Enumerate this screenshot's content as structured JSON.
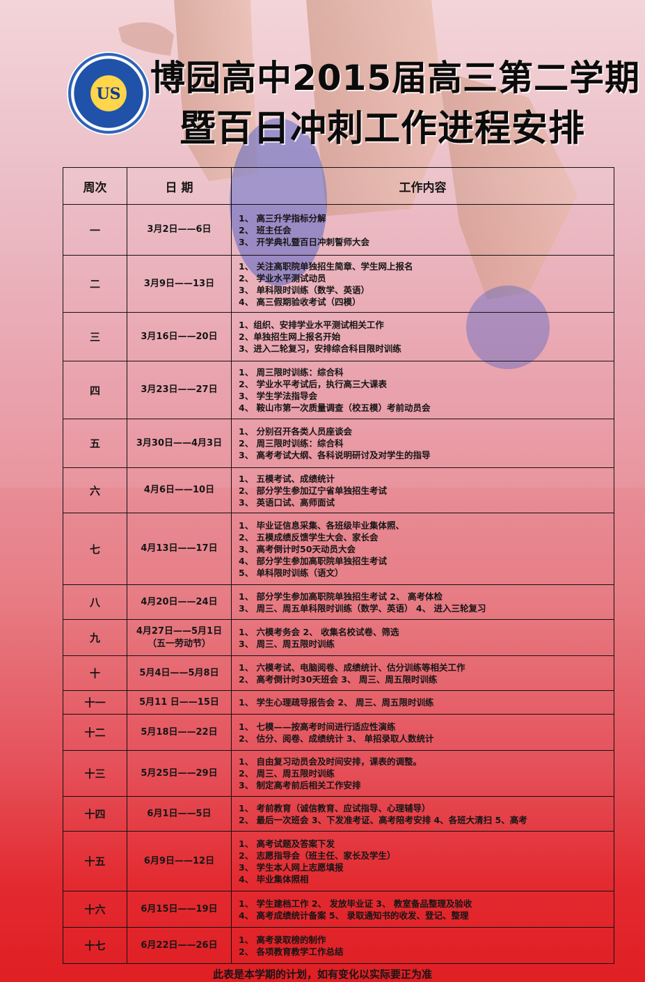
{
  "header": {
    "title_line1": "博园高中2015届高三第二学期",
    "title_line2": "暨百日冲刺工作进程安排"
  },
  "table": {
    "headers": [
      "周次",
      "日 期",
      "工作内容"
    ],
    "rows": [
      {
        "week": "一",
        "date": [
          "3月2日——6日"
        ],
        "tasks": [
          "1、 高三升学指标分解",
          "2、 班主任会",
          "3、 开学典礼暨百日冲刺誓师大会"
        ]
      },
      {
        "week": "二",
        "date": [
          "3月9日——13日"
        ],
        "tasks": [
          "1、 关注高职院单独招生简章、学生网上报名",
          "2、 学业水平测试动员",
          "3、 单科限时训练（数学、英语）",
          "4、 高三假期验收考试（四模）"
        ]
      },
      {
        "week": "三",
        "date": [
          "3月16日——20日"
        ],
        "tasks": [
          "1、组织、安排学业水平测试相关工作",
          "2、单独招生网上报名开始",
          "3、进入二轮复习，安排综合科目限时训练"
        ]
      },
      {
        "week": "四",
        "date": [
          "3月23日——27日"
        ],
        "tasks": [
          "1、 周三限时训练：综合科",
          "2、 学业水平考试后，执行高三大课表",
          "3、 学生学法指导会",
          "4、 鞍山市第一次质量调查（校五模）考前动员会"
        ]
      },
      {
        "week": "五",
        "date": [
          "3月30日——4月3日"
        ],
        "tasks": [
          "1、 分别召开各类人员座谈会",
          "2、 周三限时训练：综合科",
          "3、 高考考试大纲、各科说明研讨及对学生的指导"
        ]
      },
      {
        "week": "六",
        "date": [
          "4月6日——10日"
        ],
        "tasks": [
          "1、 五模考试、成绩统计",
          "2、 部分学生参加辽宁省单独招生考试",
          "3、 英语口试、高师面试"
        ]
      },
      {
        "week": "七",
        "date": [
          "4月13日——17日"
        ],
        "tasks": [
          "1、 毕业证信息采集、各班级毕业集体照、",
          "2、 五模成绩反馈学生大会、家长会",
          "3、 高考倒计时50天动员大会",
          "4、 部分学生参加高职院单独招生考试",
          "5、 单科限时训练（语文）"
        ]
      },
      {
        "week": "八",
        "date": [
          "4月20日——24日"
        ],
        "tasks": [
          "1、 部分学生参加高职院单独招生考试 2、 高考体检",
          "3、 周三、周五单科限时训练（数学、英语） 4、 进入三轮复习"
        ]
      },
      {
        "week": "九",
        "date": [
          "4月27日——5月1日",
          "（五一劳动节）"
        ],
        "tasks": [
          "1、 六模考务会 2、 收集名校试卷、筛选",
          "3、 周三、周五限时训练"
        ]
      },
      {
        "week": "十",
        "date": [
          "5月4日——5月8日"
        ],
        "tasks": [
          "1、 六模考试、电脑阅卷、成绩统计、估分训练等相关工作",
          "2、 高考倒计时30天班会 3、 周三、周五限时训练"
        ]
      },
      {
        "week": "十一",
        "date": [
          "5月11 日——15日"
        ],
        "tasks": [
          "1、 学生心理疏导报告会 2、 周三、周五限时训练"
        ]
      },
      {
        "week": "十二",
        "date": [
          "5月18日——22日"
        ],
        "tasks": [
          "1、 七模——按高考时间进行适应性演练",
          "2、 估分、阅卷、成绩统计 3、 单招录取人数统计"
        ]
      },
      {
        "week": "十三",
        "date": [
          "5月25日——29日"
        ],
        "tasks": [
          "1、 自由复习动员会及时间安排，课表的调整。",
          "2、 周三、周五限时训练",
          "3、 制定高考前后相关工作安排"
        ]
      },
      {
        "week": "十四",
        "date": [
          "6月1日——5日"
        ],
        "tasks": [
          "1、 考前教育（诚信教育、应试指导、心理辅导）",
          "2、 最后一次班会 3、下发准考证、高考陪考安排 4、各班大清扫 5、高考"
        ]
      },
      {
        "week": "十五",
        "date": [
          "6月9日——12日"
        ],
        "tasks": [
          "1、 高考试题及答案下发",
          "2、 志愿指导会（班主任、家长及学生）",
          "3、 学生本人网上志愿填报",
          "4、 毕业集体照相"
        ]
      },
      {
        "week": "十六",
        "date": [
          "6月15日——19日"
        ],
        "tasks": [
          "1、 学生建档工作 2、 发放毕业证 3、 教室备品整理及验收",
          "4、 高考成绩统计备案 5、 录取通知书的收发、登记、整理"
        ]
      },
      {
        "week": "十七",
        "date": [
          "6月22日——26日"
        ],
        "tasks": [
          "1、 高考录取榜的制作",
          "2、 各项教育教学工作总结"
        ]
      }
    ]
  },
  "footer": {
    "note": "此表是本学期的计划，如有变化以实际要正为准"
  },
  "colors": {
    "bg_top": "#f2d2d6",
    "bg_bottom": "#df1f24",
    "logo_blue": "#1f52a8",
    "logo_gold": "#ffd54a"
  }
}
